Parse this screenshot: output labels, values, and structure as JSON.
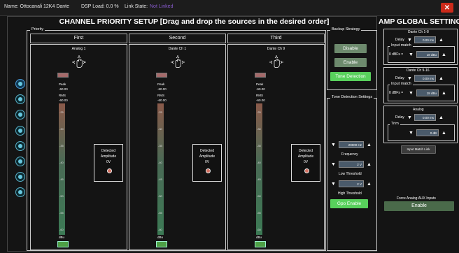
{
  "topbar": {
    "name": "Name: Ottocanali 12K4 Dante",
    "dsp": "DSP Load: 0.0 %",
    "link_label": "Link State:",
    "link_value": "Not Linked",
    "close": "✕"
  },
  "title": "CHANNEL PRIORITY SETUP [Drag and drop the sources in the desired order]",
  "priority_label": "Priority",
  "columns": [
    {
      "header": "First",
      "source": "Analog 1",
      "peak_label": "Peak",
      "peak_value": "-60.00",
      "rms_label": "RMS",
      "rms_value": "-60.00",
      "unit": "dBu",
      "detected": "Detected",
      "amplitude": "Amplitude",
      "amp_value": "0V"
    },
    {
      "header": "Second",
      "source": "Dante Ch 1",
      "peak_label": "Peak",
      "peak_value": "-60.00",
      "rms_label": "RMS",
      "rms_value": "-60.00",
      "unit": "dBu",
      "detected": "Detected",
      "amplitude": "Amplitude",
      "amp_value": "0V"
    },
    {
      "header": "Third",
      "source": "Dante Ch 9",
      "peak_label": "Peak",
      "peak_value": "-60.00",
      "rms_label": "RMS",
      "rms_value": "-60.00",
      "unit": "dBu",
      "detected": "Detected",
      "amplitude": "Amplitude",
      "amp_value": "0V"
    }
  ],
  "meter_scale": [
    "-25",
    "-30",
    "-35",
    "-40",
    "-45",
    "-50",
    "-55",
    "-60"
  ],
  "backup": {
    "label": "Backup Strategy",
    "disable": "Disable",
    "enable": "Enable",
    "tone": "Tone Detection"
  },
  "tone": {
    "label": "Tone Detection Settings",
    "freq_value": "20000 Hz",
    "freq_label": "Frequency",
    "low_value": "2 V",
    "low_label": "Low Threshold",
    "high_value": "2 V",
    "high_label": "High Threshold",
    "gpo": "Gpo Enable"
  },
  "amp": {
    "title": "AMP GLOBAL SETTINGS",
    "dante18": {
      "label": "Dante Ch 1-8",
      "delay_label": "Delay",
      "delay_value": "0.00 ms",
      "match_label": "Input match",
      "dbfs_label": "0 dBFs =",
      "match_value": "18 dBu"
    },
    "dante916": {
      "label": "Dante Ch 9-16",
      "delay_label": "Delay",
      "delay_value": "0.00 ms",
      "match_label": "Input match",
      "dbfs_label": "0 dBFs =",
      "match_value": "18 dBu"
    },
    "analog": {
      "label": "Analog",
      "delay_label": "Delay",
      "delay_value": "0.00 ms",
      "trim_label": "Trim",
      "trim_value": "0 dB"
    },
    "input_match_link": "Input Match Link",
    "force_label": "Force Analog AUX Inputs",
    "force_btn": "Enable"
  },
  "icons": {
    "up": "▲",
    "down": "▼"
  },
  "colors": {
    "accent_green": "#58d05c",
    "close_red": "#cc2a1a",
    "link_purple": "#8a5cd0"
  }
}
